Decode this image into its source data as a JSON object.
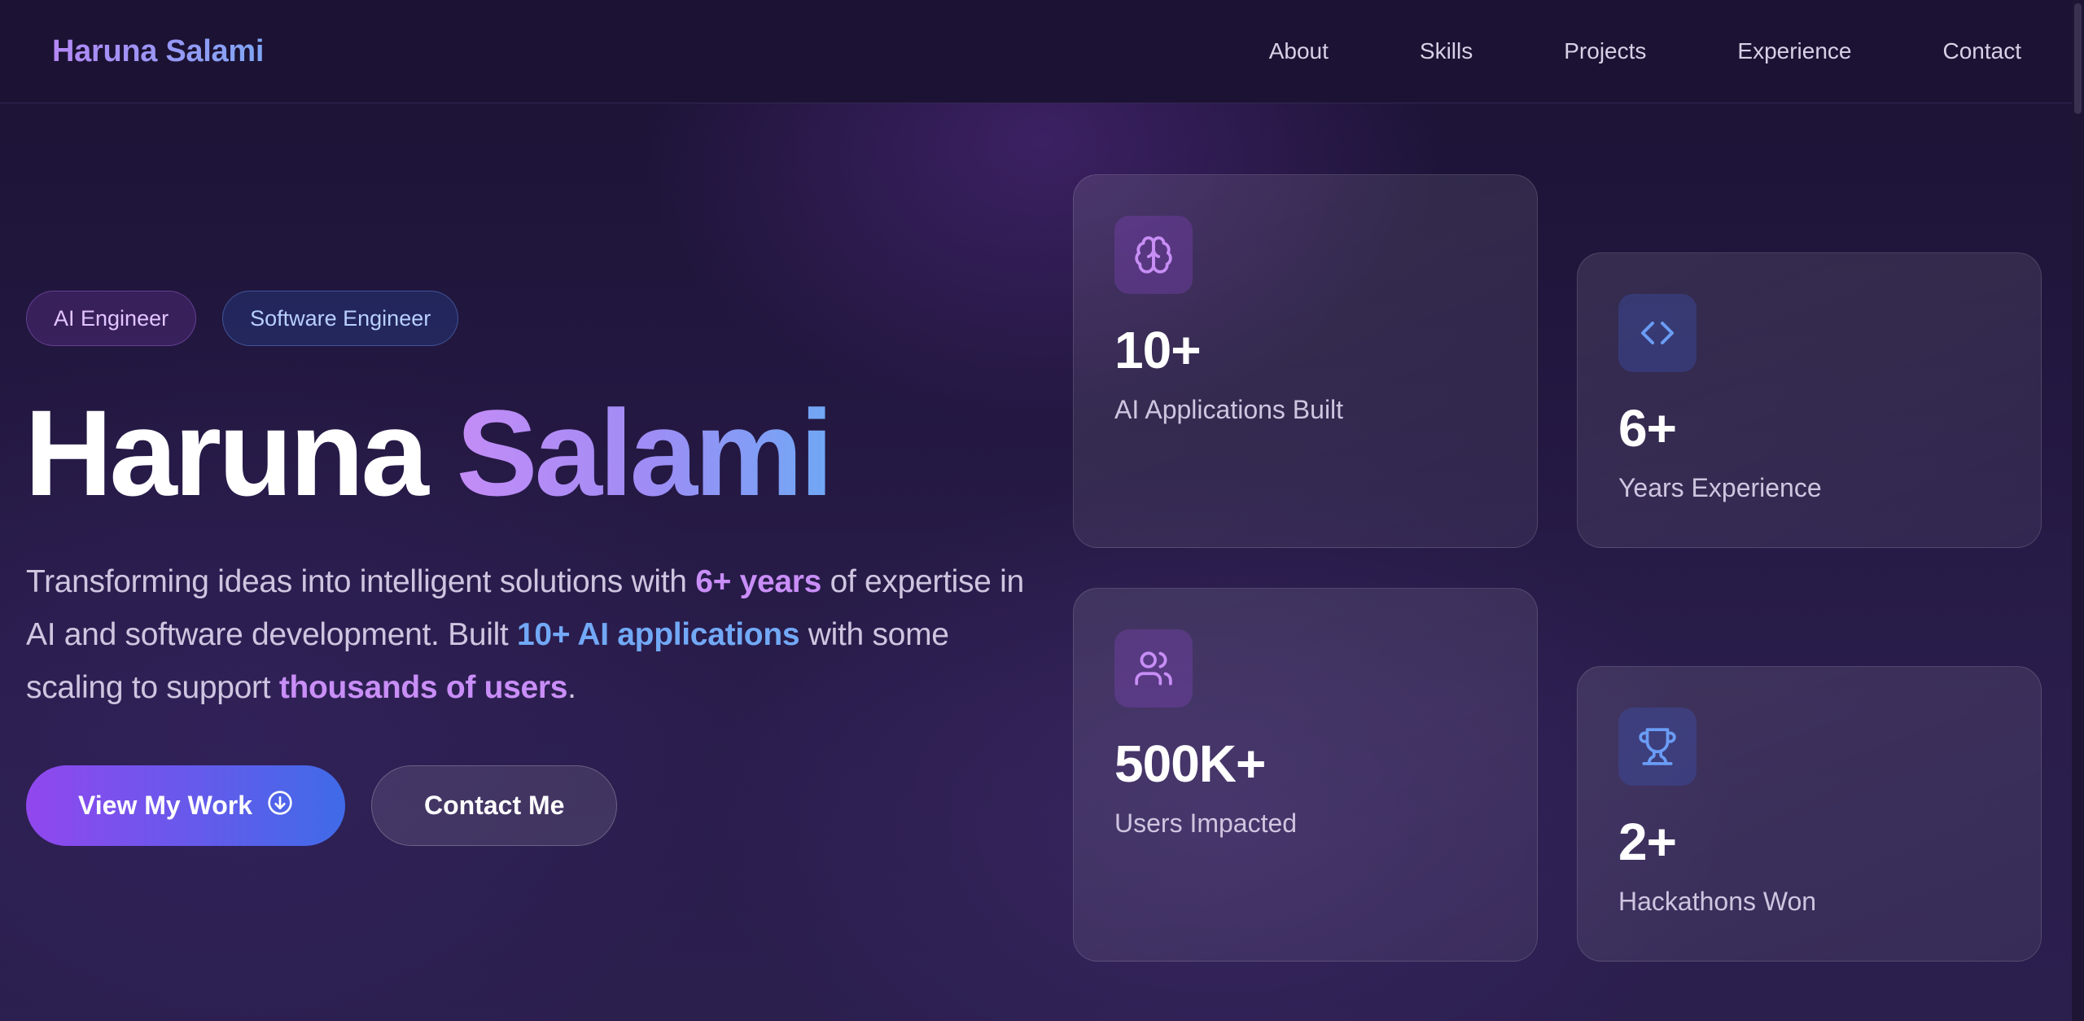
{
  "header": {
    "logo": "Haruna Salami",
    "nav": [
      "About",
      "Skills",
      "Projects",
      "Experience",
      "Contact"
    ]
  },
  "hero": {
    "badges": [
      "AI Engineer",
      "Software Engineer"
    ],
    "title_first": "Haruna",
    "title_last": "Salami",
    "description": {
      "part1": "Transforming ideas into intelligent solutions with ",
      "highlight1": "6+ years",
      "part2": " of expertise in AI and software development. Built ",
      "highlight2": "10+ AI applications",
      "part3": " with some scaling to support ",
      "highlight3": "thousands of users",
      "part4": "."
    },
    "primary_button": "View My Work",
    "secondary_button": "Contact Me"
  },
  "stats": [
    {
      "value": "10+",
      "label": "AI Applications Built",
      "icon": "brain-icon"
    },
    {
      "value": "6+",
      "label": "Years Experience",
      "icon": "code-icon"
    },
    {
      "value": "500K+",
      "label": "Users Impacted",
      "icon": "users-icon"
    },
    {
      "value": "2+",
      "label": "Hackathons Won",
      "icon": "trophy-icon"
    }
  ],
  "colors": {
    "accent_purple": "#c98ef7",
    "accent_blue": "#72a9f7",
    "background": "#22173f"
  }
}
